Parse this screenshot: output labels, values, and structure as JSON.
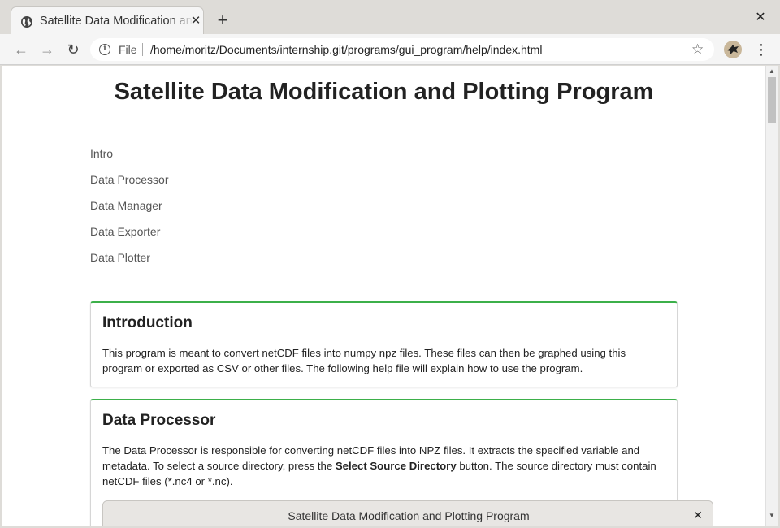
{
  "browser": {
    "tab_title": "Satellite Data Modification and Plotting Program",
    "newtab_glyph": "+",
    "close_glyph": "✕",
    "back_glyph": "←",
    "forward_glyph": "→",
    "reload_glyph": "↻",
    "info_glyph": "i",
    "scheme": "File",
    "url": "/home/moritz/Documents/internship.git/programs/gui_program/help/index.html",
    "star_glyph": "☆",
    "menu_glyph": "⋮"
  },
  "page": {
    "title": "Satellite Data Modification and Plotting Program",
    "toc": [
      {
        "label": "Intro"
      },
      {
        "label": "Data Processor"
      },
      {
        "label": "Data Manager"
      },
      {
        "label": "Data Exporter"
      },
      {
        "label": "Data Plotter"
      }
    ],
    "intro": {
      "heading": "Introduction",
      "text": "This program is meant to convert netCDF files into numpy npz files. These files can then be graphed using this program or exported as CSV or other files. The following help file will explain how to use the program."
    },
    "processor": {
      "heading": "Data Processor",
      "text_before": "The Data Processor is responsible for converting netCDF files into NPZ files. It extracts the specified variable and metadata. To select a source directory, press the ",
      "text_bold": "Select Source Directory",
      "text_after": " button. The source directory must contain netCDF files (*.nc4 or *.nc)."
    },
    "dialog": {
      "title": "Satellite Data Modification and Plotting Program",
      "close_glyph": "✕"
    }
  },
  "scrollbar": {
    "up_glyph": "▲",
    "down_glyph": "▼"
  },
  "colors": {
    "card_accent": "#3cb04a",
    "link": "#555555"
  }
}
